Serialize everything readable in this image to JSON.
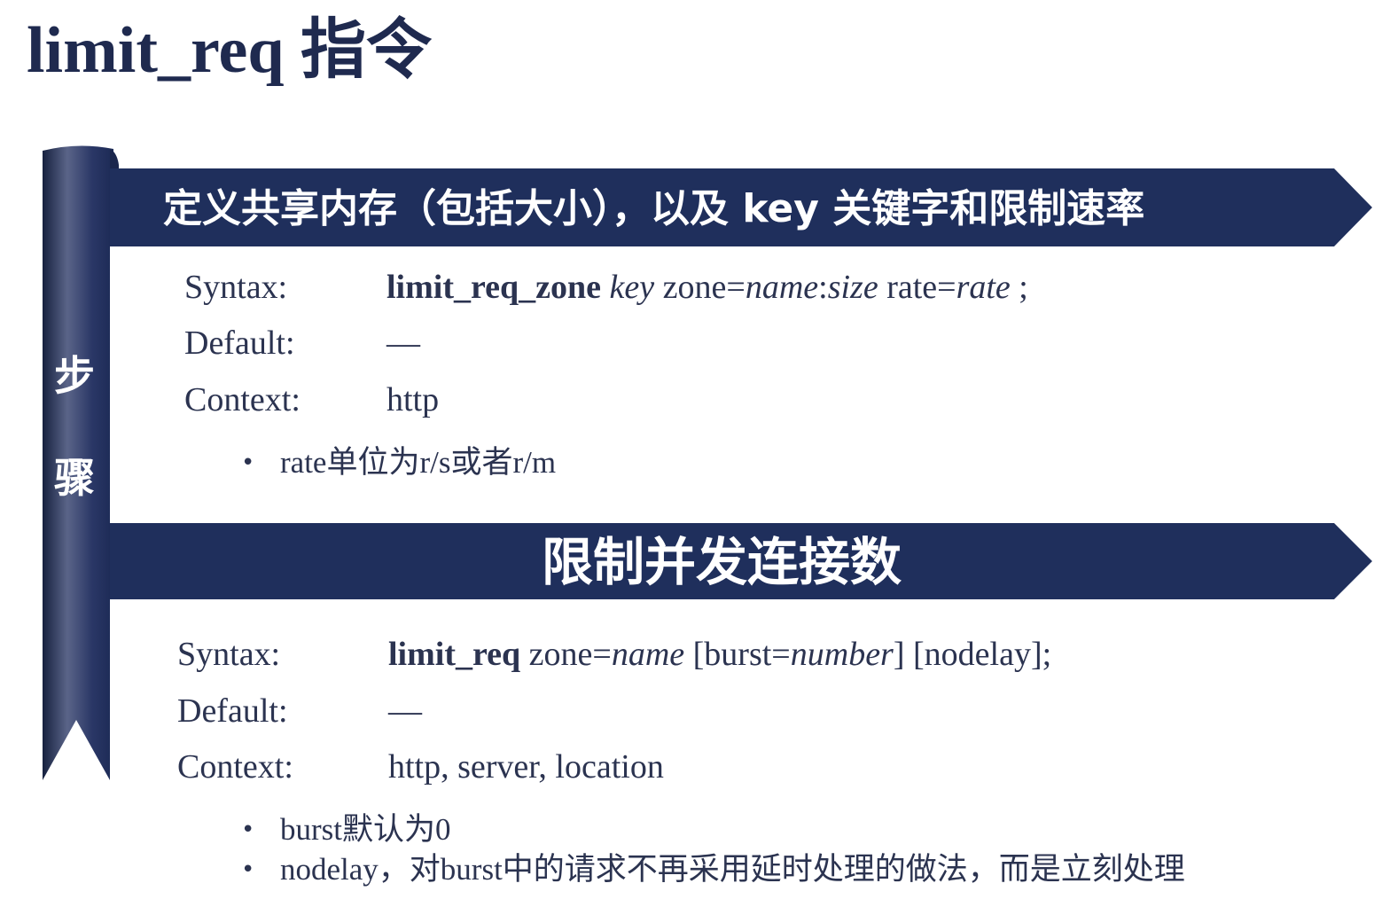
{
  "title": "limit_req 指令",
  "side_label": {
    "char1": "步",
    "char2": "骤"
  },
  "section1": {
    "banner": "定义共享内存（包括大小），以及 key 关键字和限制速率",
    "syntax_label": "Syntax:",
    "syntax": {
      "kw": "limit_req_zone",
      "key": "key",
      "t1": " zone=",
      "name": "name",
      "colon": ":",
      "size": "size",
      "t2": " rate=",
      "rate": "rate",
      "t3": " ;"
    },
    "default_label": "Default:",
    "default_value": "—",
    "context_label": "Context:",
    "context_value": "http",
    "bullets": [
      "rate单位为r/s或者r/m"
    ]
  },
  "section2": {
    "banner": "限制并发连接数",
    "syntax_label": "Syntax:",
    "syntax": {
      "kw": "limit_req",
      "t1": " zone=",
      "name": "name",
      "t2": " [burst=",
      "number": "number",
      "t3": "] [nodelay];"
    },
    "default_label": "Default:",
    "default_value": "—",
    "context_label": "Context:",
    "context_value": "http, server, location",
    "bullets": [
      "burst默认为0",
      "nodelay，对burst中的请求不再采用延时处理的做法，而是立刻处理"
    ]
  },
  "colors": {
    "banner": "#1f2f5c",
    "ribbon": "#22315e",
    "text": "#2b3350"
  }
}
